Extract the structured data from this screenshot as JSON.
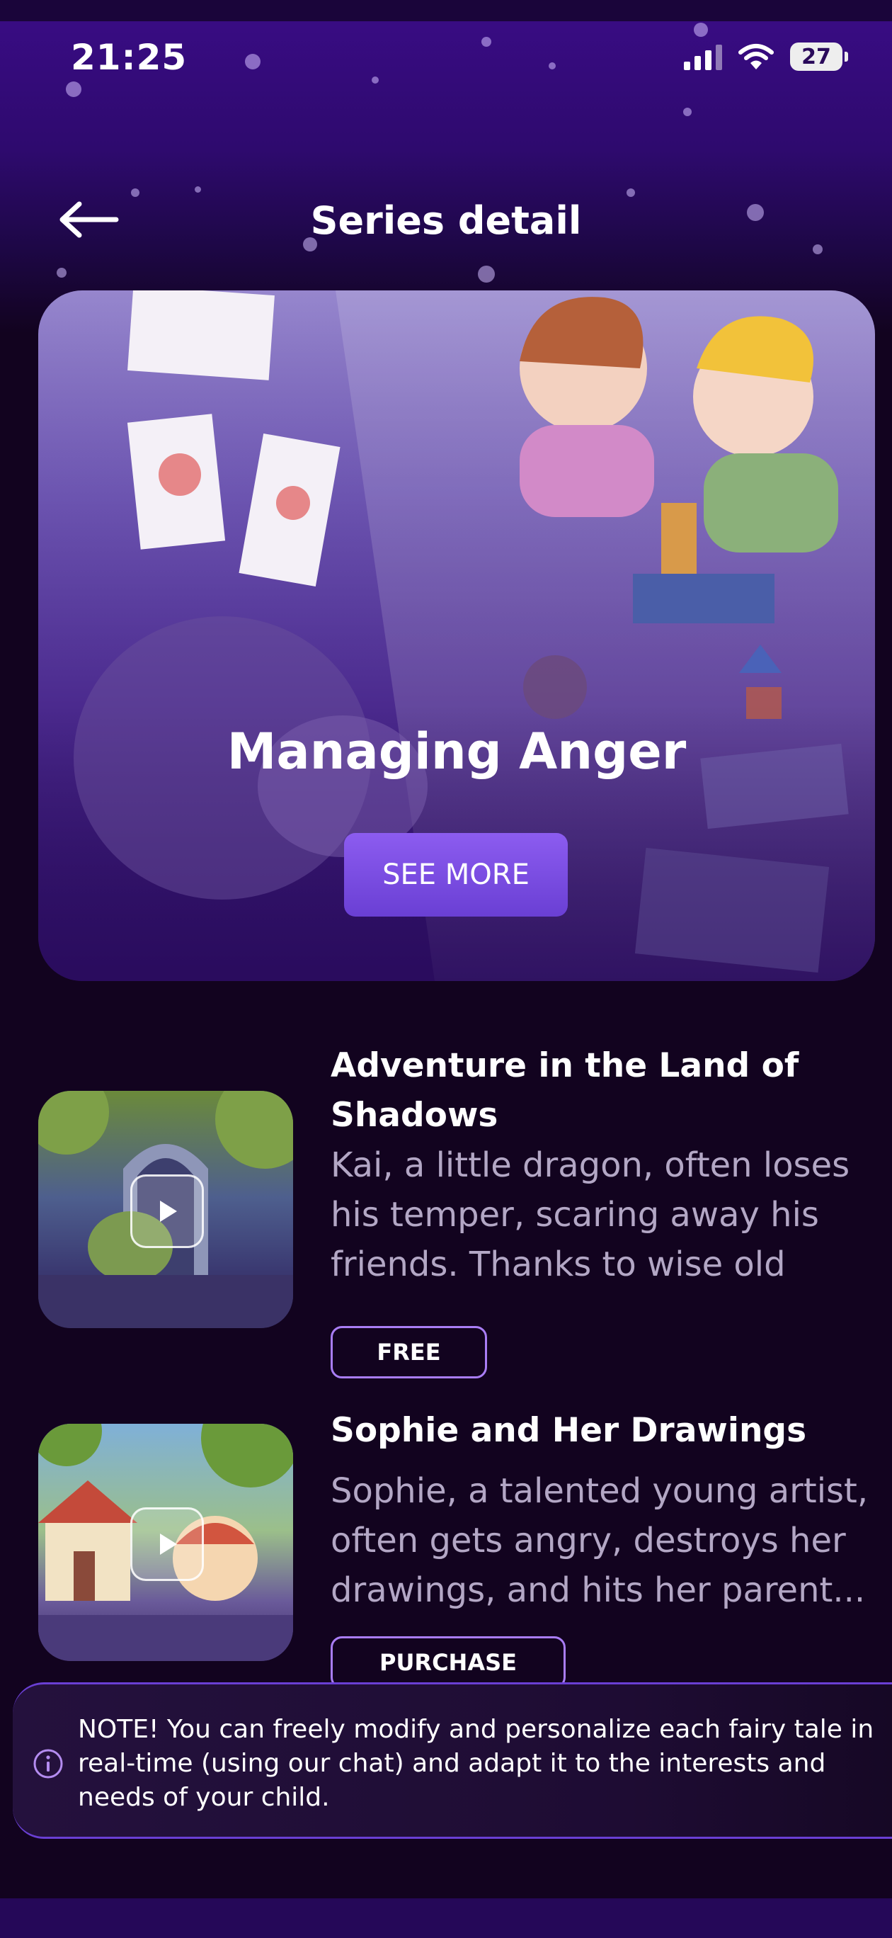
{
  "status_bar": {
    "time": "21:25",
    "battery": "27"
  },
  "header": {
    "title": "Series detail"
  },
  "hero": {
    "title": "Managing Anger",
    "button_label": "SEE MORE"
  },
  "stories": [
    {
      "title": "Adventure in the Land of Shadows",
      "description": "Kai, a little dragon, often loses his temper, scaring away his friends. Thanks to wise old bo...",
      "tag": "FREE"
    },
    {
      "title": "Sophie and Her Drawings",
      "description": "Sophie, a talented young artist, often gets angry, destroys her drawings, and hits her parent...",
      "tag": "PURCHASE"
    }
  ],
  "note": {
    "text": "NOTE! You can freely modify and personalize each fairy tale in real-time (using our chat) and adapt it to the interests and needs of your child."
  },
  "colors": {
    "accent": "#7b4fe6",
    "background": "#12031f",
    "header_purple": "#3a0c86",
    "muted_text": "#b3a7c5"
  }
}
